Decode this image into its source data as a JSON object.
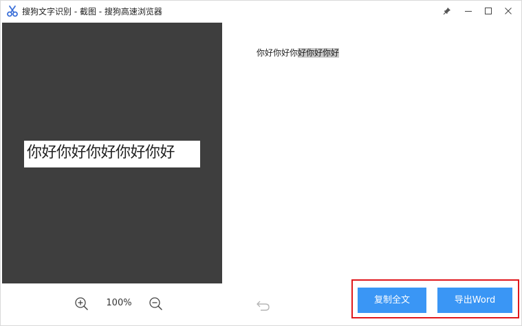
{
  "window": {
    "title": "搜狗文字识别 - 截图 - 搜狗高速浏览器",
    "accent": "#3a96f5"
  },
  "title_buttons": {
    "pin_icon": "pin-icon",
    "minimize_icon": "minimize-icon",
    "maximize_icon": "maximize-icon",
    "close_icon": "close-icon"
  },
  "preview": {
    "image_text": "你好你好你好你好你好",
    "background": "#3e3e3e"
  },
  "zoom": {
    "level": "100%",
    "zoom_in_icon": "zoom-in-icon",
    "zoom_out_icon": "zoom-out-icon"
  },
  "result": {
    "text_plain": "你好你好你",
    "text_selected": "好你好你好"
  },
  "actions": {
    "undo_icon": "undo-icon",
    "copy_all_label": "复制全文",
    "export_word_label": "导出Word",
    "highlight_color": "#e0161b"
  }
}
